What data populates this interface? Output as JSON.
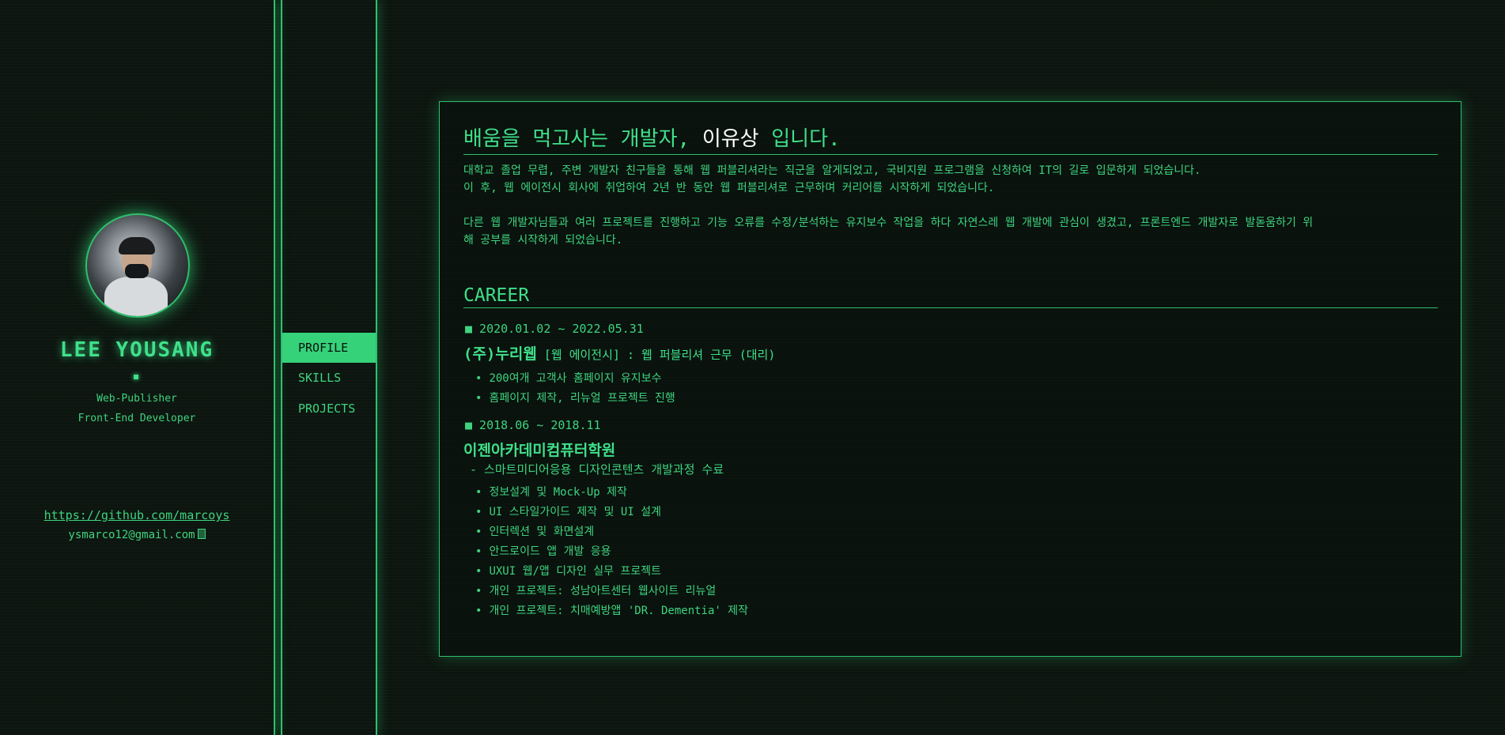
{
  "sidebar": {
    "name": "LEE YOUSANG",
    "roles": [
      "Web-Publisher",
      "Front-End Developer"
    ],
    "github": "https://github.com/marcoys",
    "email": "ysmarco12@gmail.com"
  },
  "nav": {
    "items": [
      "PROFILE",
      "SKILLS",
      "PROJECTS"
    ],
    "active": "PROFILE"
  },
  "intro": {
    "headline_pre": "배움을 먹고사는 개발자, ",
    "headline_name": "이유상",
    "headline_post": " 입니다.",
    "lines": [
      "대학교 졸업 무렵, 주변 개발자 친구들을 통해 웹 퍼블리셔라는 직군을 알게되었고, 국비지원 프로그램을 신청하여 IT의 길로 입문하게 되었습니다.",
      "이 후, 웹 에이전시 회사에 취업하여 2년 반 동안 웹 퍼블리셔로 근무하며 커리어를 시작하게 되었습니다.",
      "다른 웹 개발자님들과 여러 프로젝트를 진행하고 기능 오류를 수정/분석하는 유지보수 작업을 하다 자연스레 웹 개발에 관심이 생겼고, 프론트엔드 개발자로 발돋움하기 위",
      "해 공부를 시작하게 되었습니다."
    ]
  },
  "career": {
    "title": "CAREER",
    "entries": [
      {
        "period": "■ 2020.01.02 ~ 2022.05.31",
        "company": "(주)누리웹",
        "detail": " [웹 에이전시] : 웹 퍼블리셔 근무 (대리)",
        "bullets": [
          "200여개 고객사 홈페이지 유지보수",
          "홈페이지 제작, 리뉴얼 프로젝트 진행"
        ]
      },
      {
        "period": "■ 2018.06 ~ 2018.11",
        "company": "이젠아카데미컴퓨터학원",
        "course": "- 스마트미디어응용 디자인콘텐츠 개발과정 수료",
        "bullets": [
          "정보설계 및 Mock-Up 제작",
          "UI 스타일가이드 제작 및 UI 설계",
          "인터렉션 및 화면설계",
          "안드로이드 앱 개발 응용",
          "UXUI 웹/앱 디자인 실무 프로젝트",
          "개인 프로젝트: 성남아트센터 웹사이트 리뉴얼",
          "개인 프로젝트: 치매예방앱 'DR. Dementia' 제작"
        ]
      }
    ]
  },
  "colors": {
    "accent": "#3fe08a",
    "border": "#2fc06d",
    "background": "#0c150f",
    "highlight": "#ffffff"
  }
}
